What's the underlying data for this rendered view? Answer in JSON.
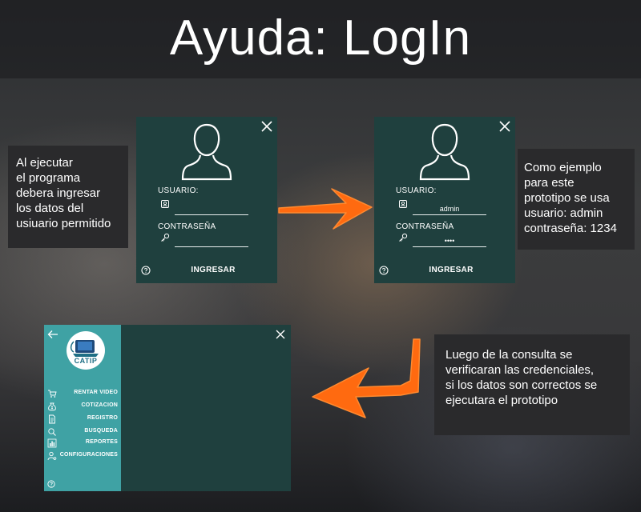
{
  "page": {
    "title": "Ayuda: LogIn"
  },
  "notes": {
    "left": [
      "Al ejecutar",
      "el programa",
      "debera ingresar",
      "los datos del",
      "usiuario permitido"
    ],
    "right": [
      "Como ejemplo",
      "para este",
      "prototipo se usa",
      "usuario: admin",
      "contraseña: 1234"
    ],
    "bottom": [
      "Luego de la consulta  se",
      "verificaran las  credenciales,",
      "si los datos son correctos se",
      "ejecutara el prototipo"
    ]
  },
  "login_empty": {
    "user_label": "USUARIO:",
    "user_value": "",
    "pass_label": "CONTRASEÑA",
    "pass_value": "",
    "submit_label": "INGRESAR"
  },
  "login_filled": {
    "user_label": "USUARIO:",
    "user_value": "admin",
    "pass_label": "CONTRASEÑA",
    "pass_value": "••••",
    "submit_label": "INGRESAR"
  },
  "main_app": {
    "logo_text": "CATIP",
    "menu": [
      {
        "label": "RENTAR VIDEO",
        "icon": "cart-icon"
      },
      {
        "label": "COTIZACION",
        "icon": "money-bag-icon"
      },
      {
        "label": "REGISTRO",
        "icon": "document-icon"
      },
      {
        "label": "BUSQUEDA",
        "icon": "search-icon"
      },
      {
        "label": "REPORTES",
        "icon": "bar-chart-icon"
      },
      {
        "label": "CONFIGURACIONES",
        "icon": "user-settings-icon"
      }
    ]
  },
  "colors": {
    "panel_bg": "#1f403e",
    "sidebar_bg": "#3fa2a4",
    "note_bg": "#2a2a2c",
    "arrow": "#ff6a10"
  }
}
